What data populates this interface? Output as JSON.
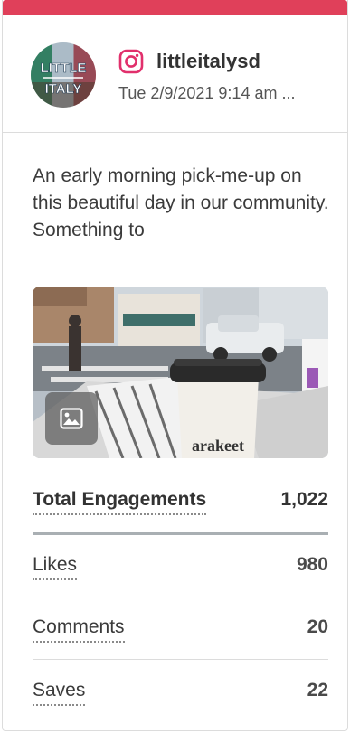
{
  "post": {
    "account_handle": "littleitalysd",
    "network_icon": "instagram-icon",
    "network_color": "#e1306c",
    "timestamp": "Tue 2/9/2021 9:14 am ...",
    "caption": "An early morning pick-me-up on this beautiful day in our community. Something to",
    "media_type_icon": "image-icon",
    "avatar_logo_text": [
      "LITTLE",
      "ITALY"
    ],
    "photo_cup_text": "arakeet"
  },
  "metrics": {
    "total": {
      "label": "Total Engagements",
      "value": "1,022"
    },
    "items": [
      {
        "label": "Likes",
        "value": "980"
      },
      {
        "label": "Comments",
        "value": "20"
      },
      {
        "label": "Saves",
        "value": "22"
      }
    ]
  },
  "colors": {
    "accent": "#e0405a",
    "divider": "#dcdcdc"
  }
}
